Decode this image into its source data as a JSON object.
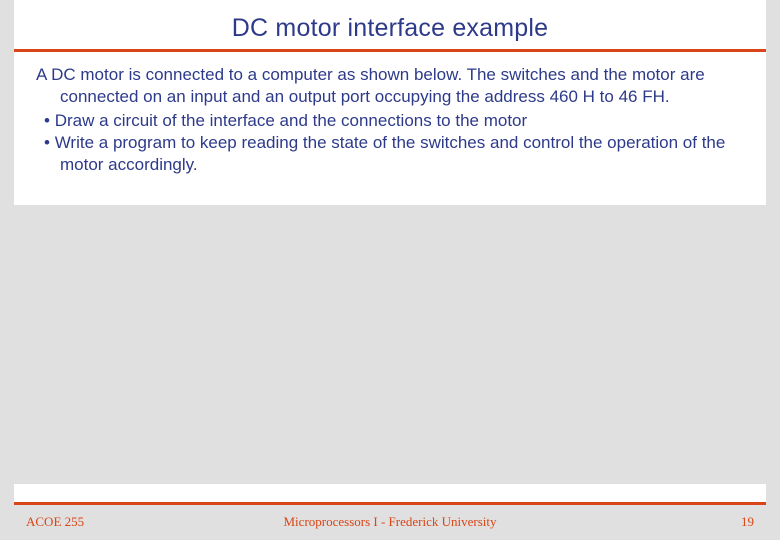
{
  "title": "DC motor interface example",
  "body": {
    "intro": "A DC motor is connected to a computer as shown below. The switches and the motor are connected on an input and an output port occupying the address 460 H to 46 FH.",
    "bullets": [
      "Draw a circuit of the interface and the connections to the motor",
      "Write a program to keep reading the state of the switches and control the operation of the motor accordingly."
    ]
  },
  "footer": {
    "left": "ACOE 255",
    "center": "Microprocessors I - Frederick University",
    "right": "19"
  }
}
